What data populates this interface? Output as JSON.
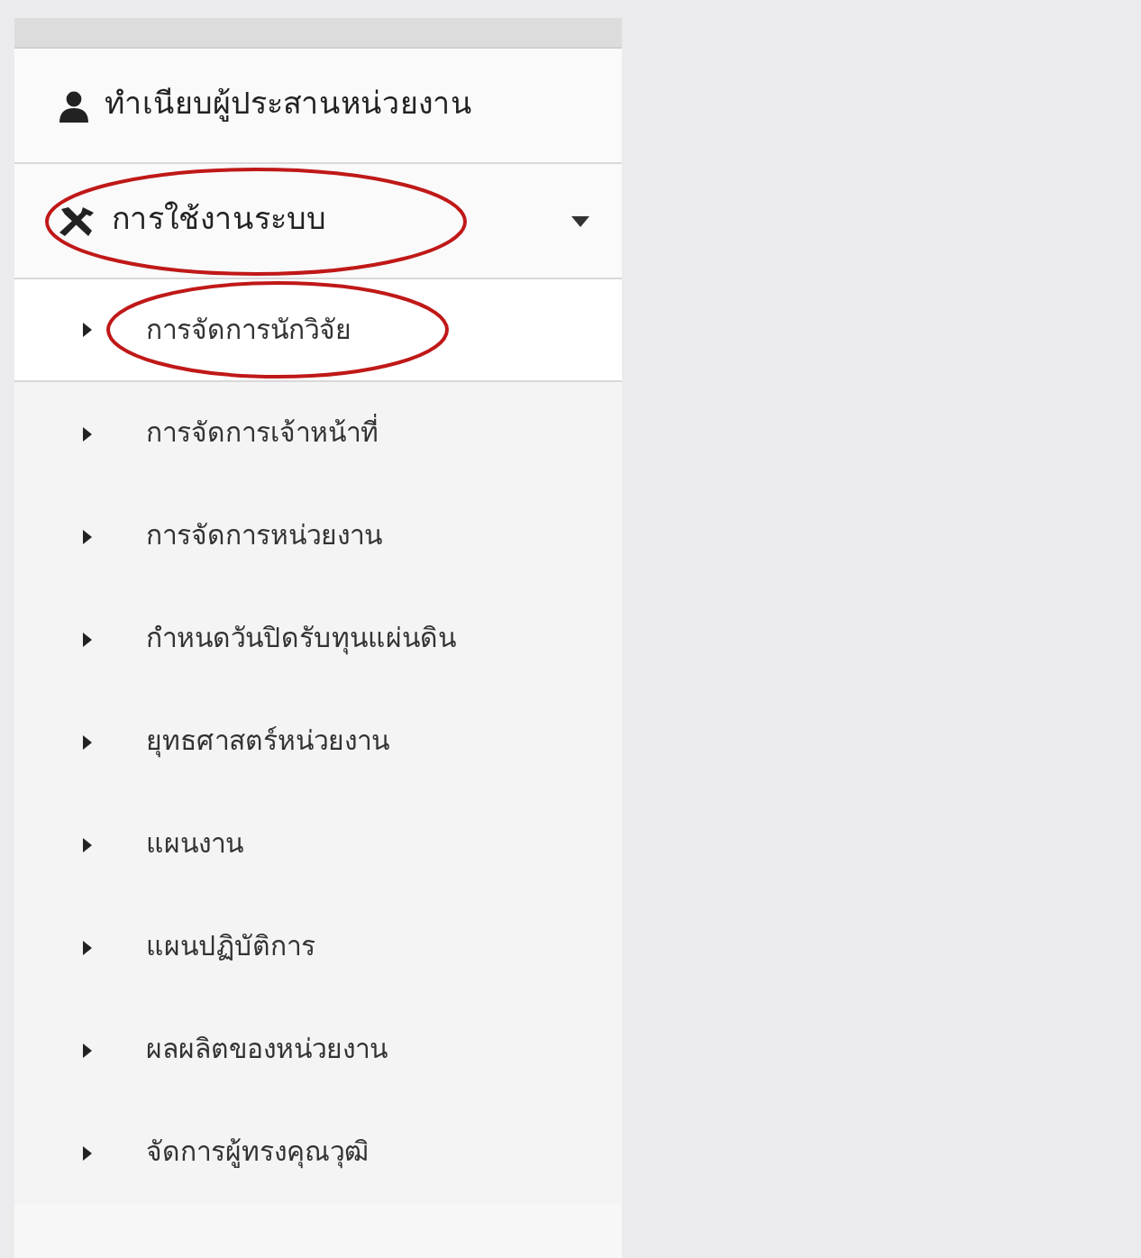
{
  "sidebar": {
    "items": [
      {
        "label": "ทำเนียบผู้ประสานหน่วยงาน",
        "kind": "user",
        "circled": false
      },
      {
        "label": "การใช้งานระบบ",
        "kind": "tools",
        "expanded": true,
        "circled": true,
        "children": [
          {
            "label": "การจัดการนักวิจัย",
            "selected": true,
            "circled": true
          },
          {
            "label": "การจัดการเจ้าหน้าที่",
            "selected": false,
            "circled": false
          },
          {
            "label": "การจัดการหน่วยงาน",
            "selected": false,
            "circled": false
          },
          {
            "label": "กำหนดวันปิดรับทุนแผ่นดิน",
            "selected": false,
            "circled": false
          },
          {
            "label": "ยุทธศาสตร์หน่วยงาน",
            "selected": false,
            "circled": false
          },
          {
            "label": "แผนงาน",
            "selected": false,
            "circled": false
          },
          {
            "label": "แผนปฏิบัติการ",
            "selected": false,
            "circled": false
          },
          {
            "label": "ผลผลิตของหน่วยงาน",
            "selected": false,
            "circled": false
          },
          {
            "label": "จัดการผู้ทรงคุณวุฒิ",
            "selected": false,
            "circled": false
          }
        ]
      }
    ]
  }
}
